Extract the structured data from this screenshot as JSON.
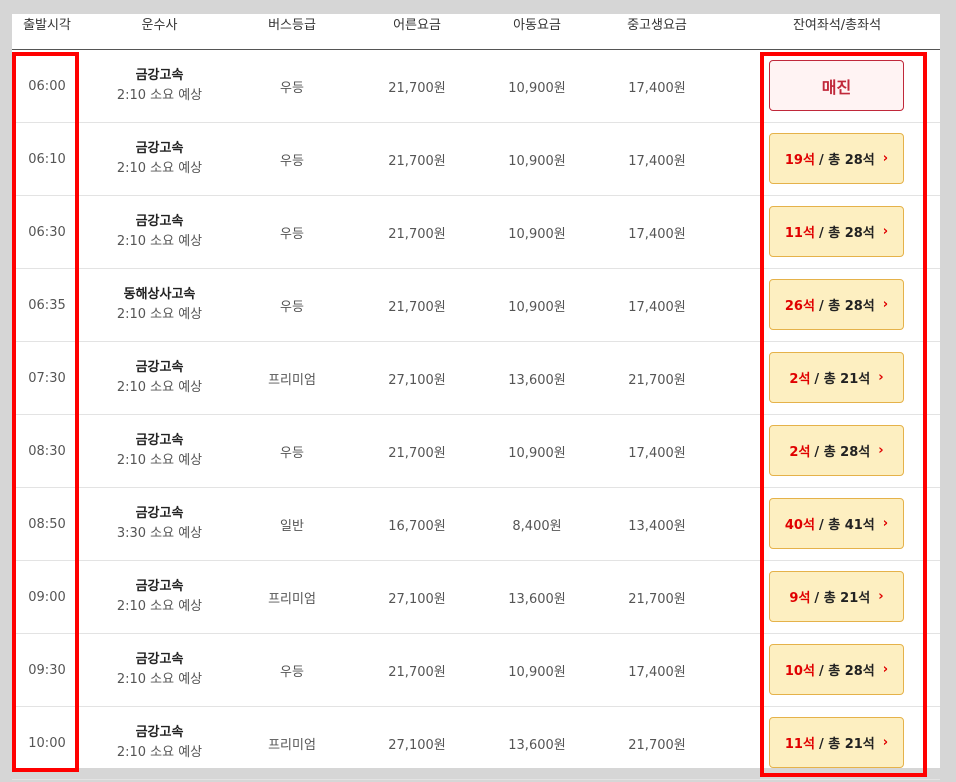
{
  "headers": {
    "departure": "출발시각",
    "company": "운수사",
    "grade": "버스등급",
    "adult": "어른요금",
    "child": "아동요금",
    "student": "중고생요금",
    "seats": "잔여좌석/총좌석"
  },
  "seat_unit": "석",
  "total_prefix": " / 총 ",
  "arrow": "›",
  "rows": [
    {
      "time": "06:00",
      "company": "금강고속",
      "duration": "2:10 소요 예상",
      "grade": "우등",
      "adult": "21,700원",
      "child": "10,900원",
      "student": "17,400원",
      "soldout": true,
      "seat_label": "매진"
    },
    {
      "time": "06:10",
      "company": "금강고속",
      "duration": "2:10 소요 예상",
      "grade": "우등",
      "adult": "21,700원",
      "child": "10,900원",
      "student": "17,400원",
      "remain": "19석",
      "total": "/ 총 28석"
    },
    {
      "time": "06:30",
      "company": "금강고속",
      "duration": "2:10 소요 예상",
      "grade": "우등",
      "adult": "21,700원",
      "child": "10,900원",
      "student": "17,400원",
      "remain": "11석",
      "total": "/ 총 28석"
    },
    {
      "time": "06:35",
      "company": "동해상사고속",
      "duration": "2:10 소요 예상",
      "grade": "우등",
      "adult": "21,700원",
      "child": "10,900원",
      "student": "17,400원",
      "remain": "26석",
      "total": "/ 총 28석"
    },
    {
      "time": "07:30",
      "company": "금강고속",
      "duration": "2:10 소요 예상",
      "grade": "프리미엄",
      "adult": "27,100원",
      "child": "13,600원",
      "student": "21,700원",
      "remain": "2석",
      "total": "/ 총 21석"
    },
    {
      "time": "08:30",
      "company": "금강고속",
      "duration": "2:10 소요 예상",
      "grade": "우등",
      "adult": "21,700원",
      "child": "10,900원",
      "student": "17,400원",
      "remain": "2석",
      "total": "/ 총 28석"
    },
    {
      "time": "08:50",
      "company": "금강고속",
      "duration": "3:30 소요 예상",
      "grade": "일반",
      "adult": "16,700원",
      "child": "8,400원",
      "student": "13,400원",
      "remain": "40석",
      "total": "/ 총 41석"
    },
    {
      "time": "09:00",
      "company": "금강고속",
      "duration": "2:10 소요 예상",
      "grade": "프리미엄",
      "adult": "27,100원",
      "child": "13,600원",
      "student": "21,700원",
      "remain": "9석",
      "total": "/ 총 21석"
    },
    {
      "time": "09:30",
      "company": "금강고속",
      "duration": "2:10 소요 예상",
      "grade": "우등",
      "adult": "21,700원",
      "child": "10,900원",
      "student": "17,400원",
      "remain": "10석",
      "total": "/ 총 28석"
    },
    {
      "time": "10:00",
      "company": "금강고속",
      "duration": "2:10 소요 예상",
      "grade": "프리미엄",
      "adult": "27,100원",
      "child": "13,600원",
      "student": "21,700원",
      "remain": "11석",
      "total": "/ 총 21석"
    }
  ],
  "colors": {
    "highlight": "#ff0000",
    "seat_button_bg": "#fdefc1",
    "seat_remaining_text": "#e00000",
    "soldout_text": "#c0283a"
  },
  "icons": {
    "seat_arrow": "chevron-right-icon"
  }
}
